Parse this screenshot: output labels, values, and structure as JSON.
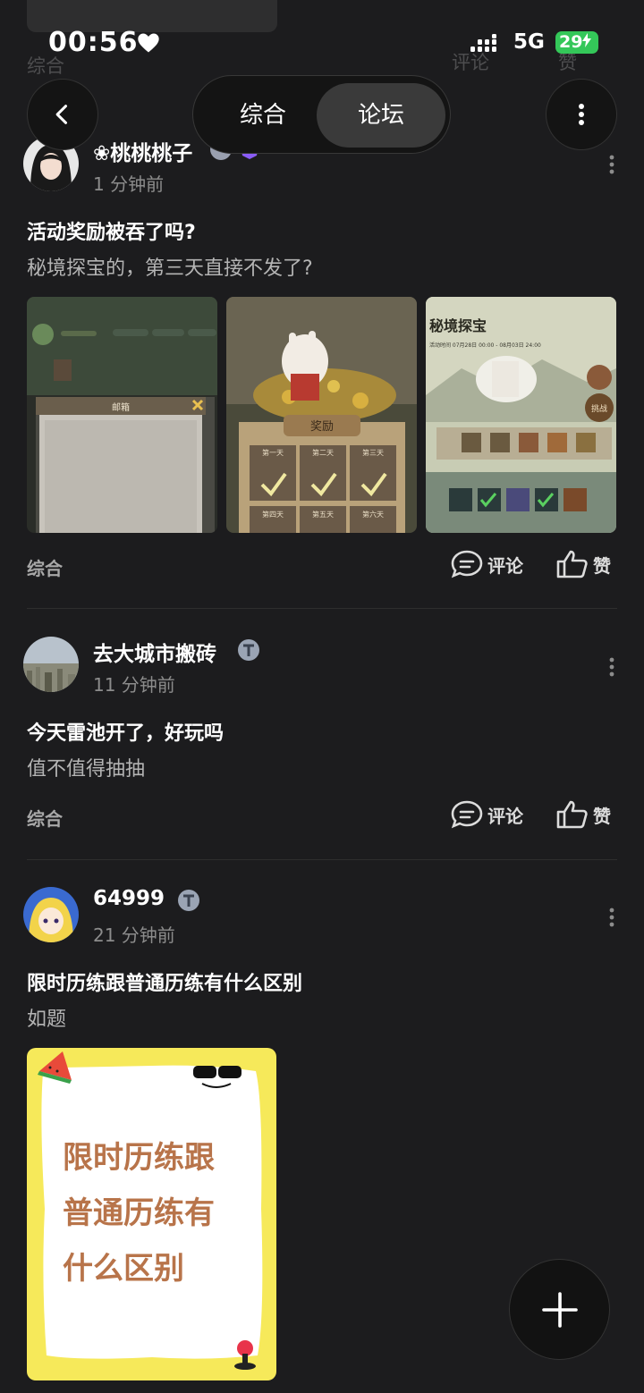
{
  "status": {
    "time": "00:56",
    "network": "5G",
    "battery": "29"
  },
  "ghost": {
    "tag": "综合",
    "comment": "评论",
    "like": "赞"
  },
  "nav": {
    "tabs": [
      "综合",
      "论坛"
    ],
    "selected": "论坛"
  },
  "posts": [
    {
      "author": "❀桃桃桃子",
      "time": "1 分钟前",
      "title": "活动奖励被吞了吗?",
      "body": "秘境探宝的，第三天直接不发了?",
      "tag": "综合",
      "comment": "评论",
      "like": "赞",
      "images": [
        "mailbox-screenshot",
        "reward-screenshot",
        "treasure-screenshot"
      ]
    },
    {
      "author": "去大城市搬砖",
      "time": "11 分钟前",
      "title": "今天雷池开了，好玩吗",
      "body": "值不值得抽抽",
      "tag": "综合",
      "comment": "评论",
      "like": "赞"
    },
    {
      "author": "64999",
      "time": "21 分钟前",
      "title": "限时历练跟普通历练有什么区别",
      "body": "如题",
      "image_text": [
        "限时历练跟",
        "普通历练有",
        "什么区别"
      ]
    }
  ],
  "screens": {
    "mail_title": "邮箱",
    "reward_title": "奖励",
    "reward_days": [
      "第一天",
      "第二天",
      "第三天",
      "第四天",
      "第五天",
      "第六天"
    ],
    "treasure_title": "秘境探宝",
    "treasure_time": "活动时间  07月28日 00:00 - 08月03日 24:00",
    "challenge": "挑战"
  },
  "colors": {
    "background": "#1c1c1e",
    "battery": "#34c759",
    "accent_badge": "#8a5cf6"
  }
}
